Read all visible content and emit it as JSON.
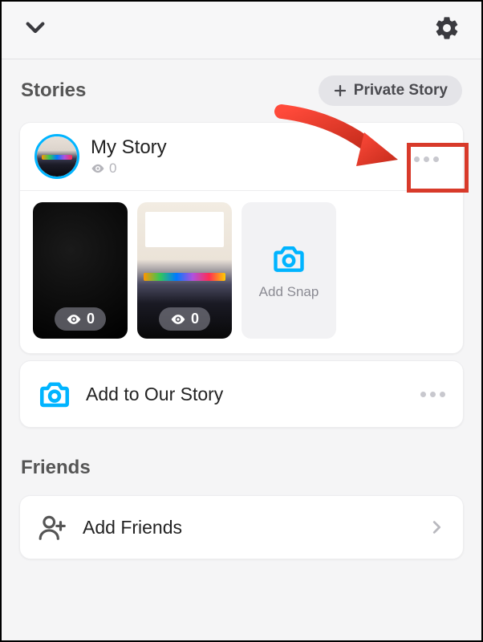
{
  "topbar": {
    "collapse_icon": "chevron-down",
    "settings_icon": "gear"
  },
  "sections": {
    "stories": {
      "title": "Stories",
      "private_story_label": "Private Story"
    },
    "friends": {
      "title": "Friends"
    }
  },
  "my_story": {
    "title": "My Story",
    "views": "0",
    "snaps": [
      {
        "views": "0"
      },
      {
        "views": "0"
      }
    ],
    "add_snap_label": "Add Snap"
  },
  "our_story": {
    "label": "Add to Our Story"
  },
  "add_friends": {
    "label": "Add Friends"
  },
  "colors": {
    "accent": "#00b4ff",
    "highlight": "#d83a2a"
  }
}
